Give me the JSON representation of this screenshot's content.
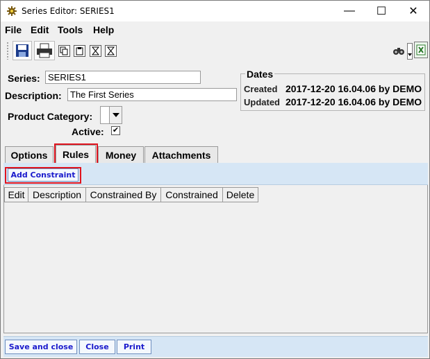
{
  "window": {
    "title": "Series Editor: SERIES1",
    "minimize_glyph": "—",
    "maximize_glyph": "☐",
    "close_glyph": "✕"
  },
  "menu": [
    "File",
    "Edit",
    "Tools",
    "Help"
  ],
  "toolbar": {
    "icons": [
      "save-icon",
      "print-icon",
      "copy-icon",
      "paste-icon",
      "hourglass-icon",
      "hourglass-icon",
      "binoculars-icon",
      "export-icon"
    ]
  },
  "form": {
    "series_label": "Series:",
    "series_value": "SERIES1",
    "description_label": "Description:",
    "description_value": "The First Series",
    "product_category_label": "Product Category:",
    "product_category_value": "",
    "active_label": "Active:",
    "active_checked": true,
    "check_glyph": "✔"
  },
  "dates": {
    "title": "Dates",
    "created_label": "Created",
    "created_value": "2017-12-20 16.04.06 by DEMO",
    "updated_label": "Updated",
    "updated_value": "2017-12-20 16.04.06 by DEMO"
  },
  "tabs": [
    {
      "label": "Options",
      "active": false
    },
    {
      "label": "Rules",
      "active": true
    },
    {
      "label": "Money",
      "active": false
    },
    {
      "label": "Attachments",
      "active": false
    }
  ],
  "rules_panel": {
    "add_constraint_label": "Add Constraint",
    "columns": [
      "Edit",
      "Description",
      "Constrained By",
      "Constrained",
      "Delete"
    ],
    "rows": []
  },
  "footer": {
    "save_close_label": "Save and close",
    "close_label": "Close",
    "print_label": "Print"
  },
  "colors": {
    "highlight_red": "#e0141e",
    "panel_blue": "#d6e6f5",
    "link_blue": "#1a1acc"
  }
}
